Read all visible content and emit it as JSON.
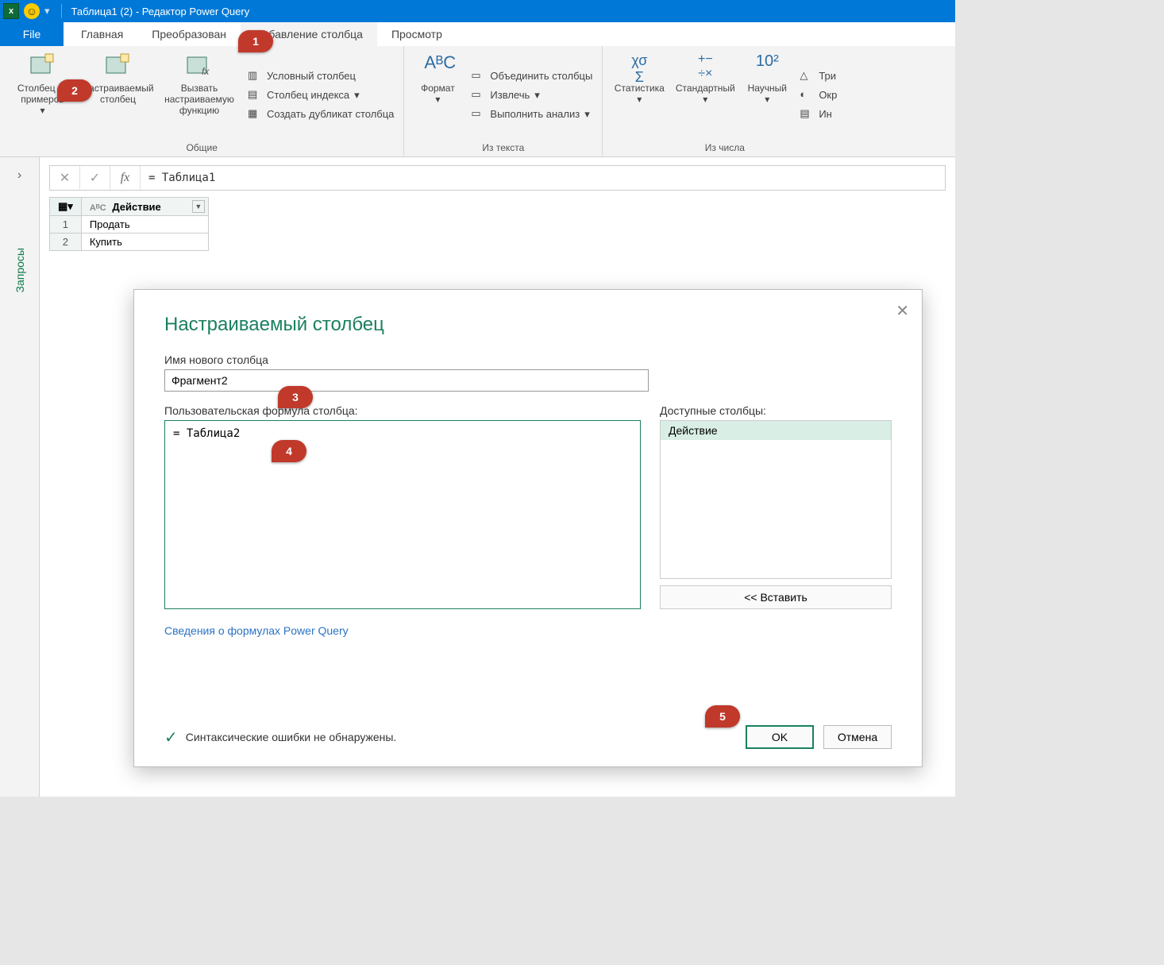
{
  "title_bar": {
    "title": "Таблица1 (2) - Редактор Power Query"
  },
  "tabs": {
    "file": "File",
    "home": "Главная",
    "transform": "Преобразован",
    "addcol": "Добавление столбца",
    "view": "Просмотр"
  },
  "ribbon": {
    "general": {
      "examples": "Столбец из примеров",
      "custom": "Настраиваемый столбец",
      "invoke": "Вызвать настраиваемую функцию",
      "conditional": "Условный столбец",
      "index": "Столбец индекса",
      "duplicate": "Создать дубликат столбца",
      "label": "Общие"
    },
    "text": {
      "format": "Формат",
      "merge": "Объединить столбцы",
      "extract": "Извлечь",
      "analyze": "Выполнить анализ",
      "label": "Из текста"
    },
    "number": {
      "stats": "Статистика",
      "standard": "Стандартный",
      "scientific": "Научный",
      "trig": "Три",
      "round": "Окр",
      "info": "Ин",
      "label": "Из числа"
    }
  },
  "side_panel": {
    "label": "Запросы"
  },
  "formula_bar": {
    "value": "= Таблица1"
  },
  "data_grid": {
    "column": "Действие",
    "type_prefix": "AᴮC",
    "rows": [
      "Продать",
      "Купить"
    ]
  },
  "dialog": {
    "title": "Настраиваемый столбец",
    "name_label": "Имя нового столбца",
    "name_value": "Фрагмент2",
    "formula_label": "Пользовательская формула столбца:",
    "formula_value": "= Таблица2",
    "available_label": "Доступные столбцы:",
    "available_item": "Действие",
    "insert": "<< Вставить",
    "info_link": "Сведения о формулах Power Query",
    "status": "Синтаксические ошибки не обнаружены.",
    "ok": "OK",
    "cancel": "Отмена"
  },
  "callouts": {
    "c1": "1",
    "c2": "2",
    "c3": "3",
    "c4": "4",
    "c5": "5"
  }
}
